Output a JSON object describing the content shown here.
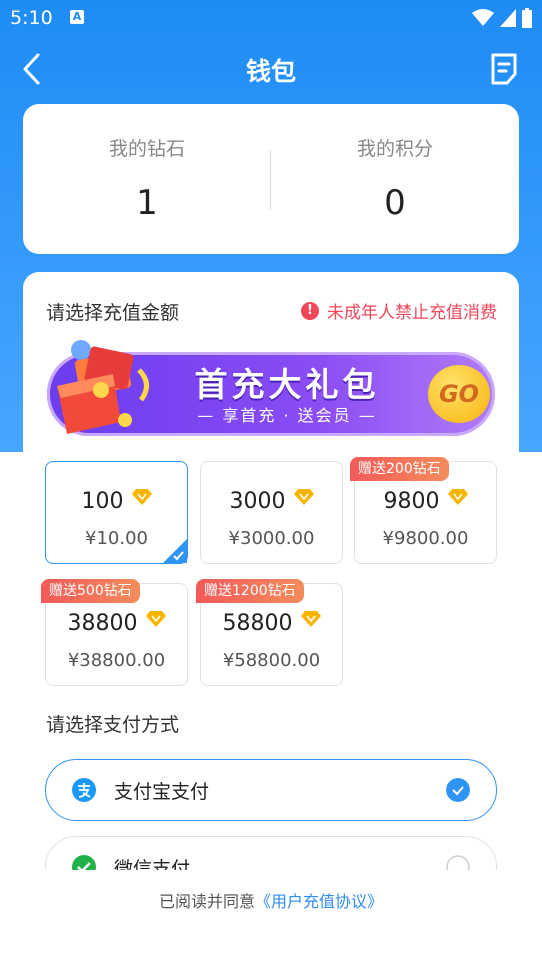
{
  "status": {
    "time": "5:10",
    "a_badge": "A"
  },
  "header": {
    "title": "钱包"
  },
  "summary": {
    "diamond_label": "我的钻石",
    "diamond_value": "1",
    "points_label": "我的积分",
    "points_value": "0"
  },
  "recharge": {
    "section_title": "请选择充值金额",
    "warning": "未成年人禁止充值消费",
    "banner": {
      "title": "首充大礼包",
      "subtitle": "— 享首充 · 送会员 —",
      "go": "GO"
    },
    "packages": [
      {
        "amount": "100",
        "price": "¥10.00",
        "bonus": "",
        "selected": true
      },
      {
        "amount": "3000",
        "price": "¥3000.00",
        "bonus": "",
        "selected": false
      },
      {
        "amount": "9800",
        "price": "¥9800.00",
        "bonus": "赠送200钻石",
        "selected": false
      },
      {
        "amount": "38800",
        "price": "¥38800.00",
        "bonus": "赠送500钻石",
        "selected": false
      },
      {
        "amount": "58800",
        "price": "¥58800.00",
        "bonus": "赠送1200钻石",
        "selected": false
      }
    ]
  },
  "payment": {
    "section_title": "请选择支付方式",
    "methods": [
      {
        "label": "支付宝支付",
        "selected": true
      },
      {
        "label": "微信支付",
        "selected": false
      }
    ]
  },
  "agreement": {
    "prefix": "已阅读并同意",
    "link": "《用户充值协议》"
  },
  "colors": {
    "primary": "#1E8CF5",
    "accent_red": "#F2465A",
    "gem": "#F7B500"
  }
}
